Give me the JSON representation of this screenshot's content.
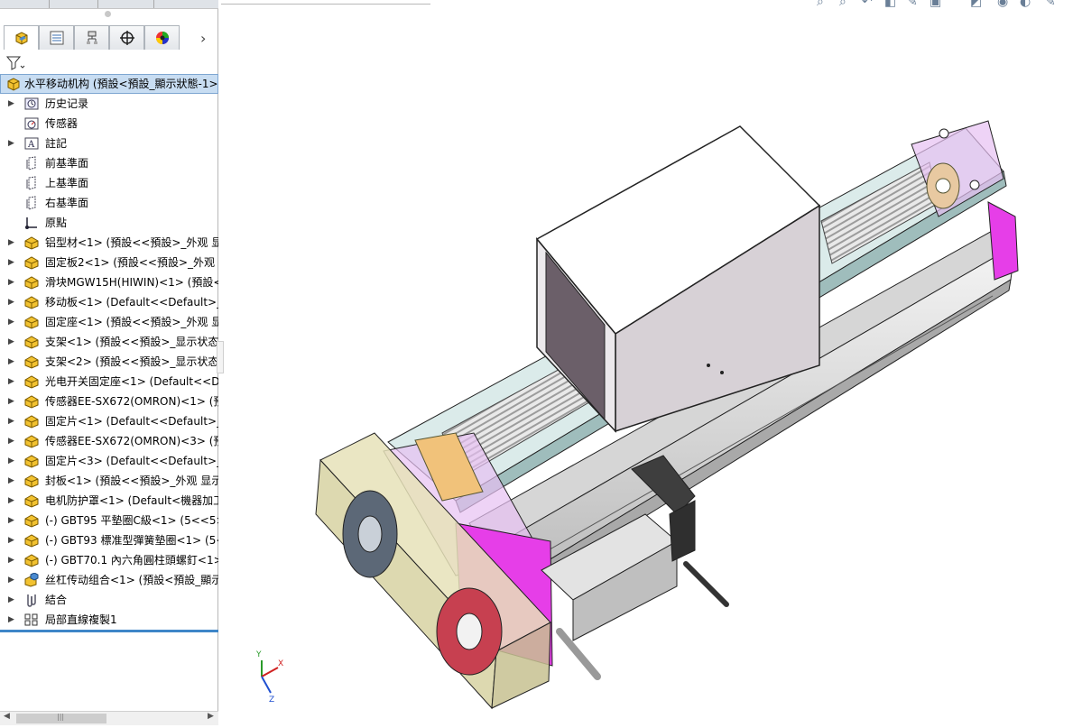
{
  "feature_tree": {
    "root": "水平移动机构 (預設<預設_顯示狀態-1>",
    "items": [
      {
        "label": "历史记录",
        "icon": "history-icon",
        "expand": true
      },
      {
        "label": "传感器",
        "icon": "sensor-icon",
        "expand": false
      },
      {
        "label": "註記",
        "icon": "annotation-icon",
        "expand": true
      },
      {
        "label": "前基準面",
        "icon": "plane-icon",
        "expand": false
      },
      {
        "label": "上基準面",
        "icon": "plane-icon",
        "expand": false
      },
      {
        "label": "右基準面",
        "icon": "plane-icon",
        "expand": false
      },
      {
        "label": "原點",
        "icon": "origin-icon",
        "expand": false
      },
      {
        "label": "铝型材<1> (預設<<預設>_外观 显示",
        "icon": "part-icon",
        "expand": true
      },
      {
        "label": "固定板2<1> (預設<<預設>_外观 显示",
        "icon": "part-icon",
        "expand": true
      },
      {
        "label": "滑块MGW15H(HIWIN)<1> (預設<<",
        "icon": "part-icon",
        "expand": true
      },
      {
        "label": "移动板<1> (Default<<Default>_外观",
        "icon": "part-icon",
        "expand": true
      },
      {
        "label": "固定座<1> (預設<<預設>_外观 显示",
        "icon": "part-icon",
        "expand": true
      },
      {
        "label": "支架<1> (預設<<預設>_显示状态",
        "icon": "part-icon",
        "expand": true
      },
      {
        "label": "支架<2> (預設<<預設>_显示状态",
        "icon": "part-icon",
        "expand": true
      },
      {
        "label": "光电开关固定座<1> (Default<<Def",
        "icon": "part-icon",
        "expand": true
      },
      {
        "label": "传感器EE-SX672(OMRON)<1> (預",
        "icon": "part-icon",
        "expand": true
      },
      {
        "label": "固定片<1> (Default<<Default>_外",
        "icon": "part-icon",
        "expand": true
      },
      {
        "label": "传感器EE-SX672(OMRON)<3> (預",
        "icon": "part-icon",
        "expand": true
      },
      {
        "label": "固定片<3> (Default<<Default>_外",
        "icon": "part-icon",
        "expand": true
      },
      {
        "label": "封板<1> (預設<<預設>_外观 显示",
        "icon": "part-icon",
        "expand": true
      },
      {
        "label": "电机防护罩<1> (Default<機器加工",
        "icon": "part-icon",
        "expand": true
      },
      {
        "label": "(-) GBT95 平墊圈C級<1> (5<<5>_",
        "icon": "part-icon",
        "expand": true
      },
      {
        "label": "(-) GBT93 標准型彈簧墊圈<1> (5<",
        "icon": "part-icon",
        "expand": true
      },
      {
        "label": "(-) GBT70.1 內六角圓柱頭螺釘<1>",
        "icon": "part-icon",
        "expand": true
      },
      {
        "label": "丝杠传动组合<1> (預設<預設_顯示",
        "icon": "subassembly-icon",
        "expand": true
      },
      {
        "label": "結合",
        "icon": "mates-icon",
        "expand": true
      },
      {
        "label": "局部直線複製1",
        "icon": "pattern-icon",
        "expand": true
      }
    ]
  },
  "panel_tabs": [
    "feature-manager-tab",
    "property-manager-tab",
    "configuration-manager-tab",
    "dimxpert-tab",
    "display-manager-tab"
  ],
  "triad": {
    "x": "X",
    "y": "Y",
    "z": "Z"
  },
  "colors": {
    "selection": "#c8ddf2",
    "accent": "#3e86c8",
    "part_yellow": "#f2c230",
    "magenta": "#e040e8"
  }
}
